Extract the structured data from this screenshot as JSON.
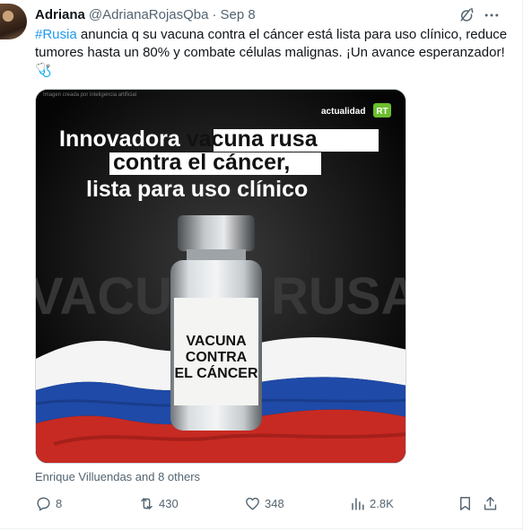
{
  "tweet": {
    "author_name": "Adriana",
    "author_handle": "@AdrianaRojasQba",
    "separator": "·",
    "date": "Sep 8",
    "hashtag": "#Rusia",
    "text_body": " anuncia q su vacuna contra el cáncer está lista para uso clínico, reduce tumores hasta un 80% y combate células malignas. ¡Un avance esperanzador! 🩺",
    "social_context": "Enrique Villuendas and 8 others"
  },
  "media": {
    "disclaimer": "Imagen creada por inteligencia artificial",
    "brand": "actualidad",
    "brand_logo": "RT",
    "headline_line1_plain": "Innovadora ",
    "headline_line1_highlight": "vacuna rusa",
    "headline_line2_highlight": "contra el cáncer,",
    "headline_line3": "lista para uso clínico",
    "background_word_left": "VACU",
    "background_word_right": "RUSA",
    "vial_label_line1": "VACUNA",
    "vial_label_line2": "CONTRA",
    "vial_label_line3": "EL CÁNCER"
  },
  "actions": {
    "replies": "8",
    "reposts": "430",
    "likes": "348",
    "views": "2.8K"
  },
  "icons": {
    "grok": "grok-icon",
    "more": "more-icon",
    "reply": "reply-icon",
    "repost": "repost-icon",
    "like": "like-icon",
    "views": "views-icon",
    "bookmark": "bookmark-icon",
    "share": "share-icon"
  },
  "colors": {
    "accent": "#1d9bf0",
    "secondary_text": "#536471",
    "primary_text": "#0f1419",
    "rt_green": "#6bbf2f"
  }
}
